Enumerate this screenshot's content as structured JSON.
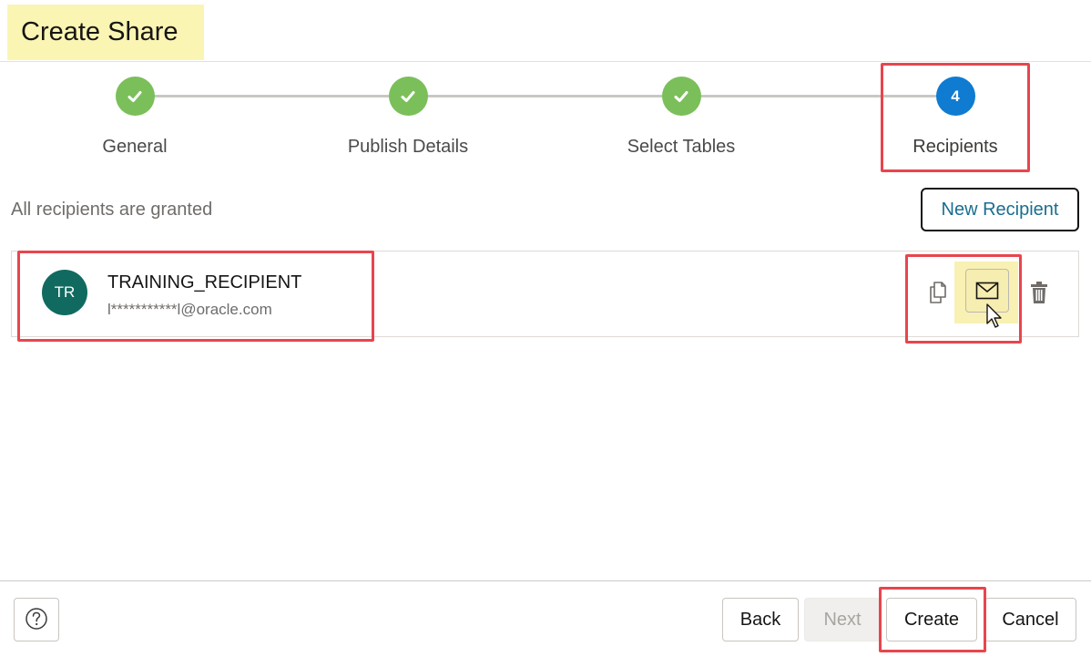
{
  "header": {
    "title": "Create Share"
  },
  "train": {
    "steps": [
      {
        "label": "General",
        "status": "complete"
      },
      {
        "label": "Publish Details",
        "status": "complete"
      },
      {
        "label": "Select Tables",
        "status": "complete"
      },
      {
        "label": "Recipients",
        "status": "current",
        "number": "4"
      }
    ]
  },
  "recipients": {
    "hint": "All recipients are granted",
    "new_button_label": "New Recipient",
    "items": [
      {
        "initials": "TR",
        "name": "TRAINING_RECIPIENT",
        "email": "l***********l@oracle.com"
      }
    ],
    "icons": {
      "copy": "copy-icon",
      "email": "email-icon",
      "delete": "trash-icon"
    }
  },
  "footer": {
    "help_icon": "help-icon",
    "back_label": "Back",
    "next_label": "Next",
    "create_label": "Create",
    "cancel_label": "Cancel"
  },
  "colors": {
    "step_complete": "#7bbf5a",
    "step_current": "#0f7bd1",
    "avatar": "#116a60",
    "highlight_yellow": "#fbf5b4",
    "annotation_red": "#e8454d",
    "link_blue": "#1a6d8f"
  }
}
